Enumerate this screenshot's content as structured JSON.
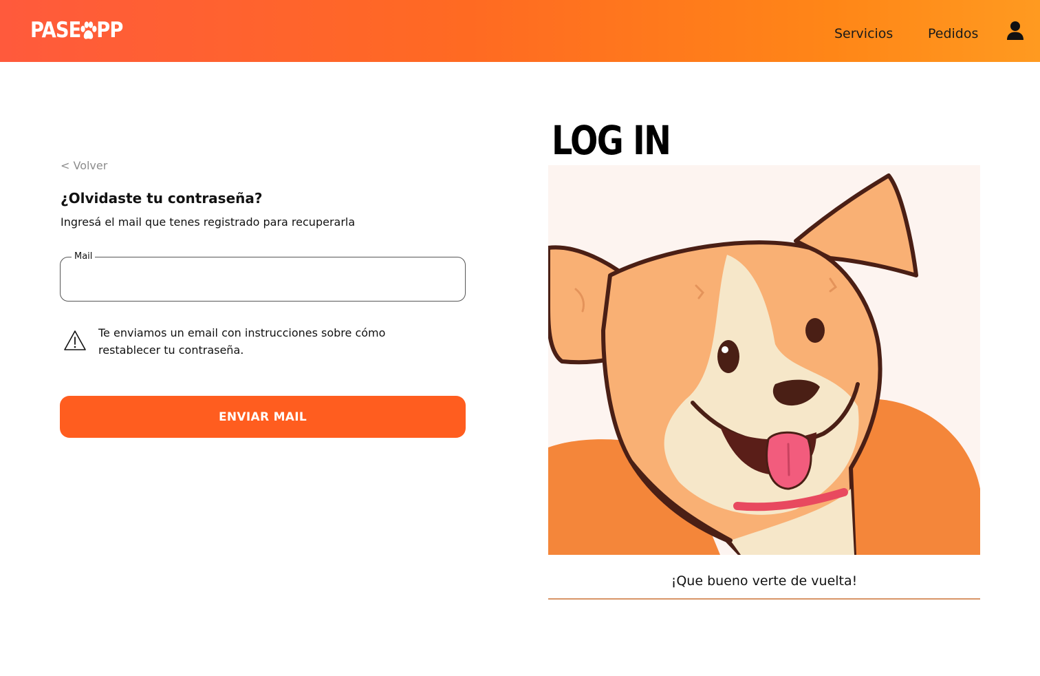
{
  "brand": {
    "logo_pre": "PASE",
    "logo_post": "PP",
    "colors": {
      "gradient_start": "#ff5a3c",
      "gradient_end": "#ff9a20",
      "button": "#ff5d1f",
      "divider": "#d89466"
    }
  },
  "nav": {
    "items": [
      {
        "label": "Servicios"
      },
      {
        "label": "Pedidos"
      }
    ],
    "user_icon": "user-icon"
  },
  "form": {
    "back_label": "< Volver",
    "title": "¿Olvidaste tu contraseña?",
    "subtitle": "Ingresá el mail que tenes registrado para recuperarla",
    "mail_label": "Mail",
    "mail_value": "",
    "notice_icon": "warning-icon",
    "notice_text": "Te enviamos un email con instrucciones sobre cómo restablecer tu contraseña.",
    "submit_label": "ENVIAR MAIL"
  },
  "hero": {
    "heading": "LOG IN",
    "illustration": "dog-illustration",
    "welcome_text": "¡Que bueno verte de vuelta!"
  }
}
